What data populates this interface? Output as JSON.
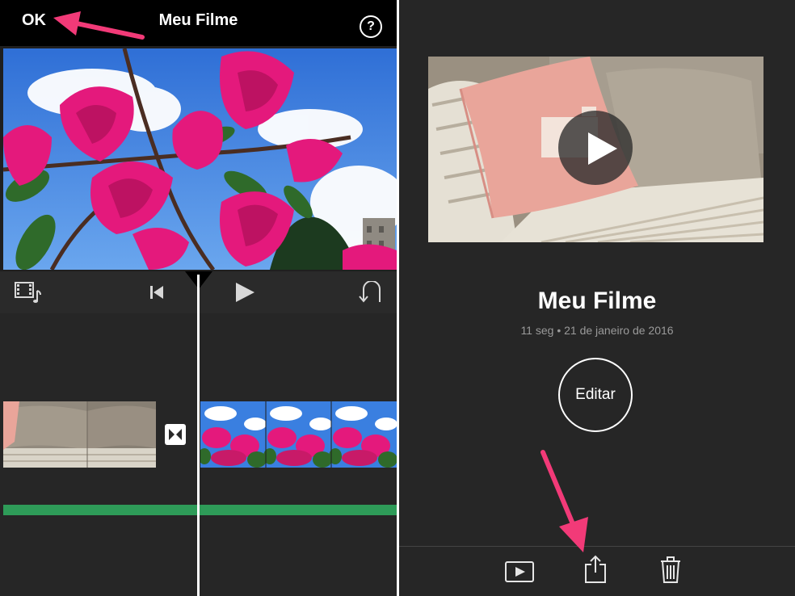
{
  "editor": {
    "ok_label": "OK",
    "title": "Meu Filme",
    "help_label": "?"
  },
  "project": {
    "title": "Meu Filme",
    "meta": "11 seg • 21 de janeiro de 2016",
    "edit_label": "Editar"
  },
  "icons": {
    "media_browser": "film-music-icon",
    "skip_start": "skip-to-start-icon",
    "play": "play-icon",
    "undo": "undo-icon",
    "transition": "transition-icon",
    "play_movie": "play-movie-icon",
    "share": "share-icon",
    "trash": "trash-icon"
  },
  "colors": {
    "annotation_arrow": "#f23a78",
    "audio_track": "#2e9b58"
  }
}
